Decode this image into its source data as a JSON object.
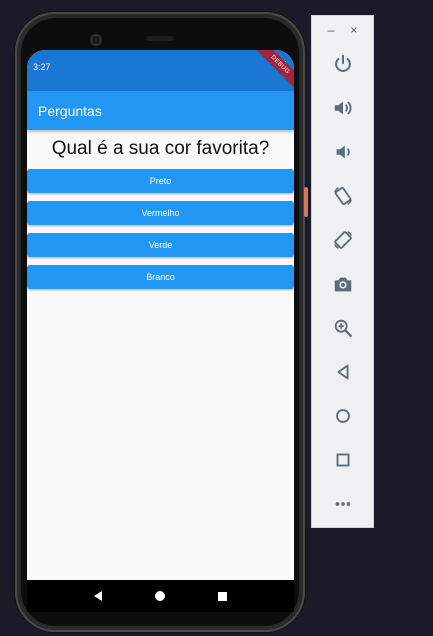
{
  "device": {
    "status_time": "3:27",
    "debug_label": "DEBUG"
  },
  "app": {
    "title": "Perguntas",
    "question": "Qual é a sua cor favorita?",
    "answers": [
      "Preto",
      "Vermelho",
      "Verde",
      "Branco"
    ]
  },
  "toolbar": {
    "minimize": "–",
    "close": "×"
  },
  "colors": {
    "status_bar": "#1976d2",
    "app_bar": "#2196f3",
    "button": "#2196f3",
    "icon": "#5b6b78"
  }
}
